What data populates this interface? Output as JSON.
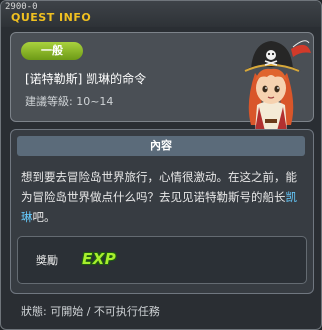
{
  "window": {
    "id_label": "2900-0",
    "title": "QUEST INFO"
  },
  "quest": {
    "category": "一般",
    "name": "[诺特勒斯] 凯琳的命令",
    "level_text": "建議等級: 10~14",
    "portrait_icon": "pirate-captain-portrait-icon"
  },
  "content": {
    "header": "內容",
    "description_before": "想到要去冒险岛世界旅行，心情很激动。在这之前，能为冒险岛世界做点什么吗？去见见诺特勒斯号的船长",
    "npc_name": "凯琳",
    "description_after": "吧。",
    "npc_color": "#66ccff"
  },
  "reward": {
    "label": "獎勵",
    "exp_text": "EXP",
    "exp_icon": "exp-icon"
  },
  "status": {
    "text": "狀態: 可開始 / 不可执行任務"
  }
}
